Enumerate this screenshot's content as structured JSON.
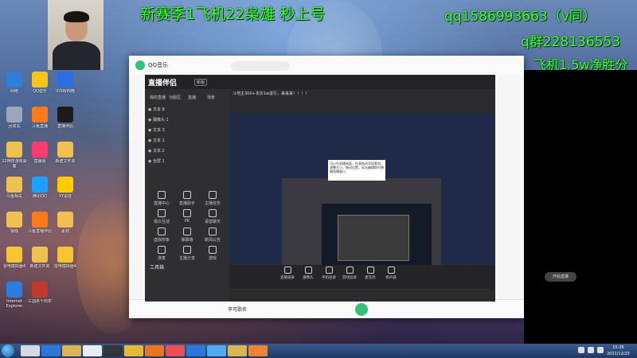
{
  "overlay": {
    "headline": "新赛季1飞机22枭雄 秒上号",
    "qq": "qq1586993663（v同）",
    "qq_group": "q群228136553",
    "slogan": "飞机1.5w净胜分"
  },
  "desktop_icons": [
    {
      "label": "网络",
      "color": "#2f7fd8"
    },
    {
      "label": "QQ音乐",
      "color": "#f5c518"
    },
    {
      "label": "IOSWIN微",
      "color": "#2b6ee0"
    },
    {
      "label": "回收站",
      "color": "#9aa7b8"
    },
    {
      "label": "斗鱼直播",
      "color": "#ff7a1a"
    },
    {
      "label": "直播伴侣",
      "color": "#1b1b1b"
    },
    {
      "label": "22神技游戏桌面",
      "color": "#f0c050"
    },
    {
      "label": "直播易",
      "color": "#ff3b6b"
    },
    {
      "label": "新建文件夹",
      "color": "#f0c050"
    },
    {
      "label": "斗鱼相关",
      "color": "#f0c050"
    },
    {
      "label": "腾讯QQ",
      "color": "#1ea0ff"
    },
    {
      "label": "YY语音",
      "color": "#ffcc00"
    },
    {
      "label": "钢铁",
      "color": "#f0c050"
    },
    {
      "label": "斗鱼直播伴侣",
      "color": "#ff7a1a"
    },
    {
      "label": "素材",
      "color": "#f0c050"
    },
    {
      "label": "雷电模拟器4",
      "color": "#f7c531"
    },
    {
      "label": "新建文件夹",
      "color": "#f0c050"
    },
    {
      "label": "雷电模拟器4",
      "color": "#f7c531"
    },
    {
      "label": "Internet Explorer",
      "color": "#2a7de1"
    },
    {
      "label": "三国杀十周年",
      "color": "#c0392b"
    }
  ],
  "qq_music": {
    "app_title": "QQ音乐",
    "song": "李可歌名"
  },
  "live": {
    "app_name": "直播伴侣",
    "badge": "新版",
    "tabs": [
      "我的直播",
      "功能区",
      "直播",
      "场景"
    ],
    "scenes": [
      "文本 8",
      "摄像头 1",
      "文本 3",
      "文本 1",
      "文本 2",
      "全屏 1"
    ],
    "top_info": "斗地主300+本次1w进行，来来来！！！！",
    "toolbox_title": "工具箱",
    "tools": [
      "直播中心",
      "直播助手",
      "主播任务",
      "观众互动",
      "PK",
      "语音聊天",
      "虚拟形象",
      "弹幕墙",
      "新闻公告",
      "连麦",
      "主播分享",
      "游戏"
    ],
    "bottom_tools": [
      "直播录屏",
      "摄像头",
      "手机投屏",
      "游戏投屏",
      "麦克风",
      "扬声器"
    ],
    "go_live_label": "开始直播",
    "tooltip": "可以在直播画面，任意拖动添加素材，调整大小，拖动位置，双击编辑即时弹幕直播窗口"
  },
  "taskbar": {
    "time": "15:26",
    "date": "2021/12/23",
    "items": [
      "#e8e8e8",
      "#2a7de1",
      "#f0c050",
      "#ffffff",
      "#333333",
      "#f7c531",
      "#ff7a1a",
      "#ff5050",
      "#2a7de1",
      "#58b4ff",
      "#f0c050",
      "#ff8c2a"
    ]
  }
}
